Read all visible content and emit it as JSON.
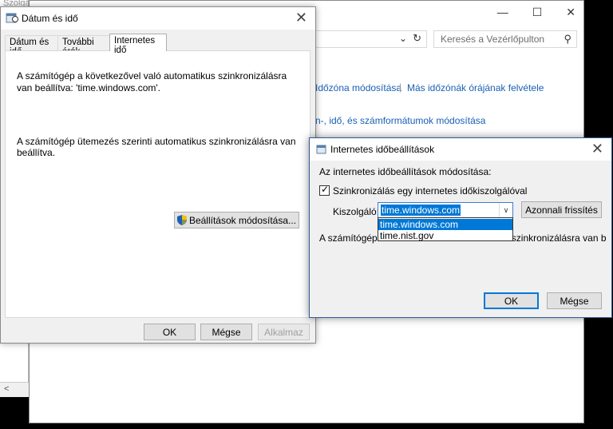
{
  "strip": {
    "title": "Szolgáltatások"
  },
  "control_panel": {
    "window_controls": {
      "minimize": "—",
      "maximize": "☐",
      "close": "✕"
    },
    "search_placeholder": "Keresés a Vezérlőpulton",
    "links": {
      "timezone": "Időzóna módosítása",
      "separator": "|",
      "clocks": "Más időzónák órájának felvétele",
      "formats": "n-, idő, és számformátumok módosítása"
    }
  },
  "datetime_dialog": {
    "title": "Dátum és idő",
    "close": "✕",
    "tabs": [
      "Dátum és idő",
      "További órák",
      "Internetes idő"
    ],
    "sync_text": "A számítógép a következővel való automatikus szinkronizálásra van beállítva: 'time.windows.com'.",
    "schedule_text": "A számítógép ütemezés szerinti automatikus szinkronizálásra van beállítva.",
    "change_settings_button": "Beállítások módosítása...",
    "ok": "OK",
    "cancel": "Mégse",
    "apply": "Alkalmaz"
  },
  "internet_time_dialog": {
    "title": "Internetes időbeállítások",
    "close": "✕",
    "heading": "Az internetes időbeállítások módosítása:",
    "checkbox_label": "Szinkronizálás egy internetes időkiszolgálóval",
    "checkbox_checked": true,
    "server_label": "Kiszolgáló:",
    "server_value": "time.windows.com",
    "server_options": [
      "time.windows.com",
      "time.nist.gov"
    ],
    "update_now": "Azonnali frissítés",
    "status_text": "A számítógép ütemezés szerinti automatikus szinkronizálásra van beállítva.",
    "ok": "OK",
    "cancel": "Mégse"
  },
  "colors": {
    "accent": "#0078d7",
    "link": "#1a5fb4",
    "dialog_bg": "#f0f0f0"
  }
}
